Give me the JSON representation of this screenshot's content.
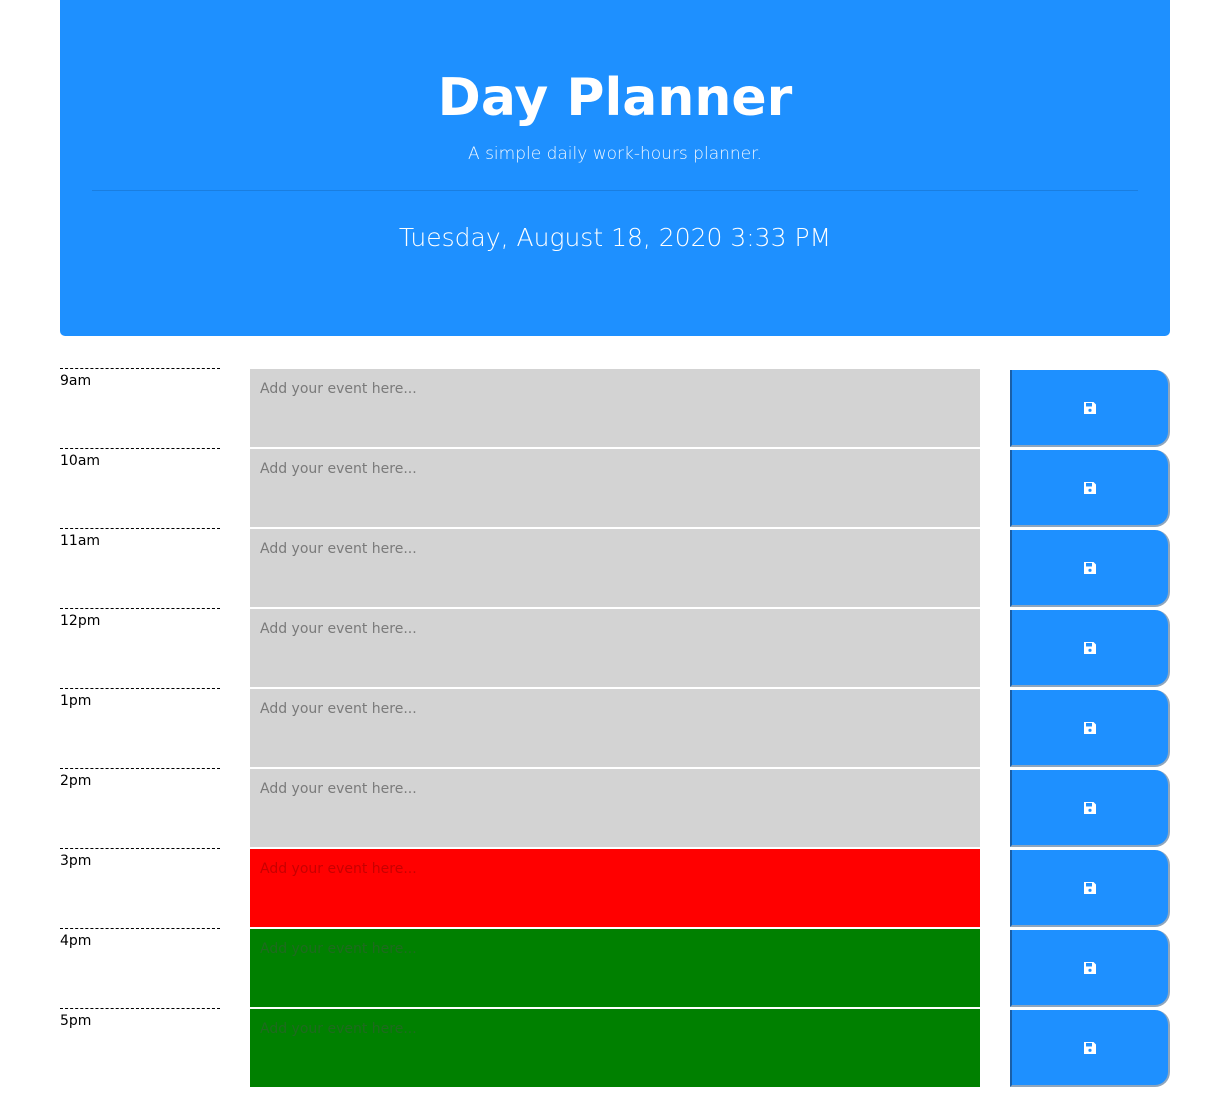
{
  "header": {
    "title": "Day Planner",
    "subtitle": "A simple daily work-hours planner.",
    "current_datetime": "Tuesday, August 18, 2020 3:33 PM",
    "background_color": "#1e90ff"
  },
  "timeblocks": [
    {
      "hour": "9am",
      "placeholder": "Add your event here...",
      "value": "",
      "status": "past",
      "save_icon": "floppy-disk-icon"
    },
    {
      "hour": "10am",
      "placeholder": "Add your event here...",
      "value": "",
      "status": "past",
      "save_icon": "floppy-disk-icon"
    },
    {
      "hour": "11am",
      "placeholder": "Add your event here...",
      "value": "",
      "status": "past",
      "save_icon": "floppy-disk-icon"
    },
    {
      "hour": "12pm",
      "placeholder": "Add your event here...",
      "value": "",
      "status": "past",
      "save_icon": "floppy-disk-icon"
    },
    {
      "hour": "1pm",
      "placeholder": "Add your event here...",
      "value": "",
      "status": "past",
      "save_icon": "floppy-disk-icon"
    },
    {
      "hour": "2pm",
      "placeholder": "Add your event here...",
      "value": "",
      "status": "past",
      "save_icon": "floppy-disk-icon"
    },
    {
      "hour": "3pm",
      "placeholder": "Add your event here...",
      "value": "",
      "status": "present",
      "save_icon": "floppy-disk-icon"
    },
    {
      "hour": "4pm",
      "placeholder": "Add your event here...",
      "value": "",
      "status": "future",
      "save_icon": "floppy-disk-icon"
    },
    {
      "hour": "5pm",
      "placeholder": "Add your event here...",
      "value": "",
      "status": "future",
      "save_icon": "floppy-disk-icon"
    }
  ],
  "colors": {
    "past": "#d3d3d3",
    "present": "#ff0000",
    "future": "#008000",
    "save_button": "#1e90ff"
  }
}
